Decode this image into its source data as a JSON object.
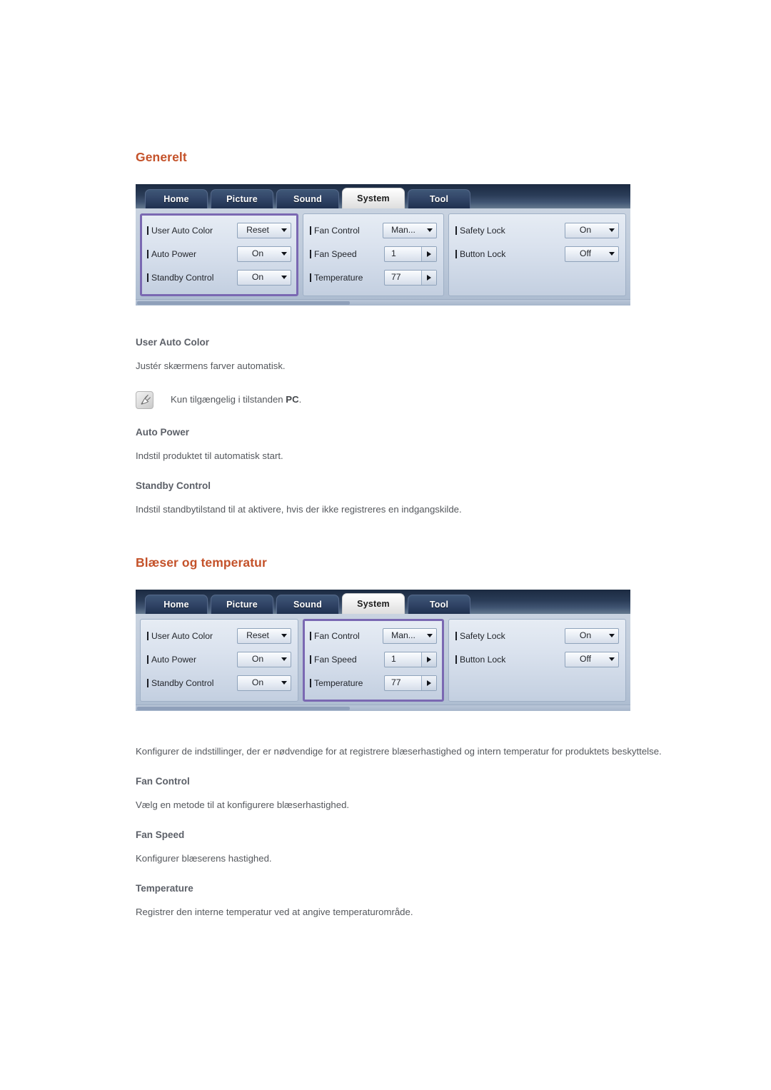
{
  "document": {
    "sections": [
      {
        "id": "generelt",
        "heading": "Generelt",
        "highlight_panel": 0
      },
      {
        "id": "blaeser-og-temperatur",
        "heading": "Blæser og temperatur",
        "highlight_panel": 1
      }
    ]
  },
  "osd": {
    "tabs": [
      {
        "label": "Home",
        "active": false
      },
      {
        "label": "Picture",
        "active": false
      },
      {
        "label": "Sound",
        "active": false
      },
      {
        "label": "System",
        "active": true
      },
      {
        "label": "Tool",
        "active": false
      }
    ],
    "panels": [
      {
        "name": "general-panel",
        "rows": [
          {
            "label": "User Auto Color",
            "value": "Reset",
            "control": "dropdown"
          },
          {
            "label": "Auto Power",
            "value": "On",
            "control": "dropdown"
          },
          {
            "label": "Standby Control",
            "value": "On",
            "control": "dropdown"
          }
        ]
      },
      {
        "name": "fan-temperature-panel",
        "rows": [
          {
            "label": "Fan Control",
            "value": "Man...",
            "control": "dropdown"
          },
          {
            "label": "Fan Speed",
            "value": "1",
            "control": "spinner"
          },
          {
            "label": "Temperature",
            "value": "77",
            "control": "spinner"
          }
        ]
      },
      {
        "name": "lock-panel",
        "rows": [
          {
            "label": "Safety Lock",
            "value": "On",
            "control": "dropdown"
          },
          {
            "label": "Button Lock",
            "value": "Off",
            "control": "dropdown"
          }
        ]
      }
    ]
  },
  "section1": {
    "heading": "Generelt",
    "items": [
      {
        "title": "User Auto Color",
        "body": "Justér skærmens farver automatisk."
      },
      {
        "title": "Auto Power",
        "body": "Indstil produktet til automatisk start."
      },
      {
        "title": "Standby Control",
        "body": "Indstil standbytilstand til at aktivere, hvis der ikke registreres en indgangskilde."
      }
    ],
    "note": {
      "icon": "note-pencil-icon",
      "text_before": "Kun tilgængelig i tilstanden ",
      "emphasis": "PC",
      "text_after": "."
    }
  },
  "section2": {
    "heading": "Blæser og temperatur",
    "intro": "Konfigurer de indstillinger, der er nødvendige for at registrere blæserhastighed og intern temperatur for produktets beskyttelse.",
    "items": [
      {
        "title": "Fan Control",
        "body": "Vælg en metode til at konfigurere blæserhastighed."
      },
      {
        "title": "Fan Speed",
        "body": "Konfigurer blæserens hastighed."
      },
      {
        "title": "Temperature",
        "body": "Registrer den interne temperatur ved at angive temperaturområde."
      }
    ]
  },
  "colors": {
    "heading_orange": "#c4522a",
    "subheading_gray": "#5c6068",
    "body_gray": "#55585d",
    "highlight_purple": "#7a68b2",
    "tabbar_navy": "#1b2a41"
  }
}
